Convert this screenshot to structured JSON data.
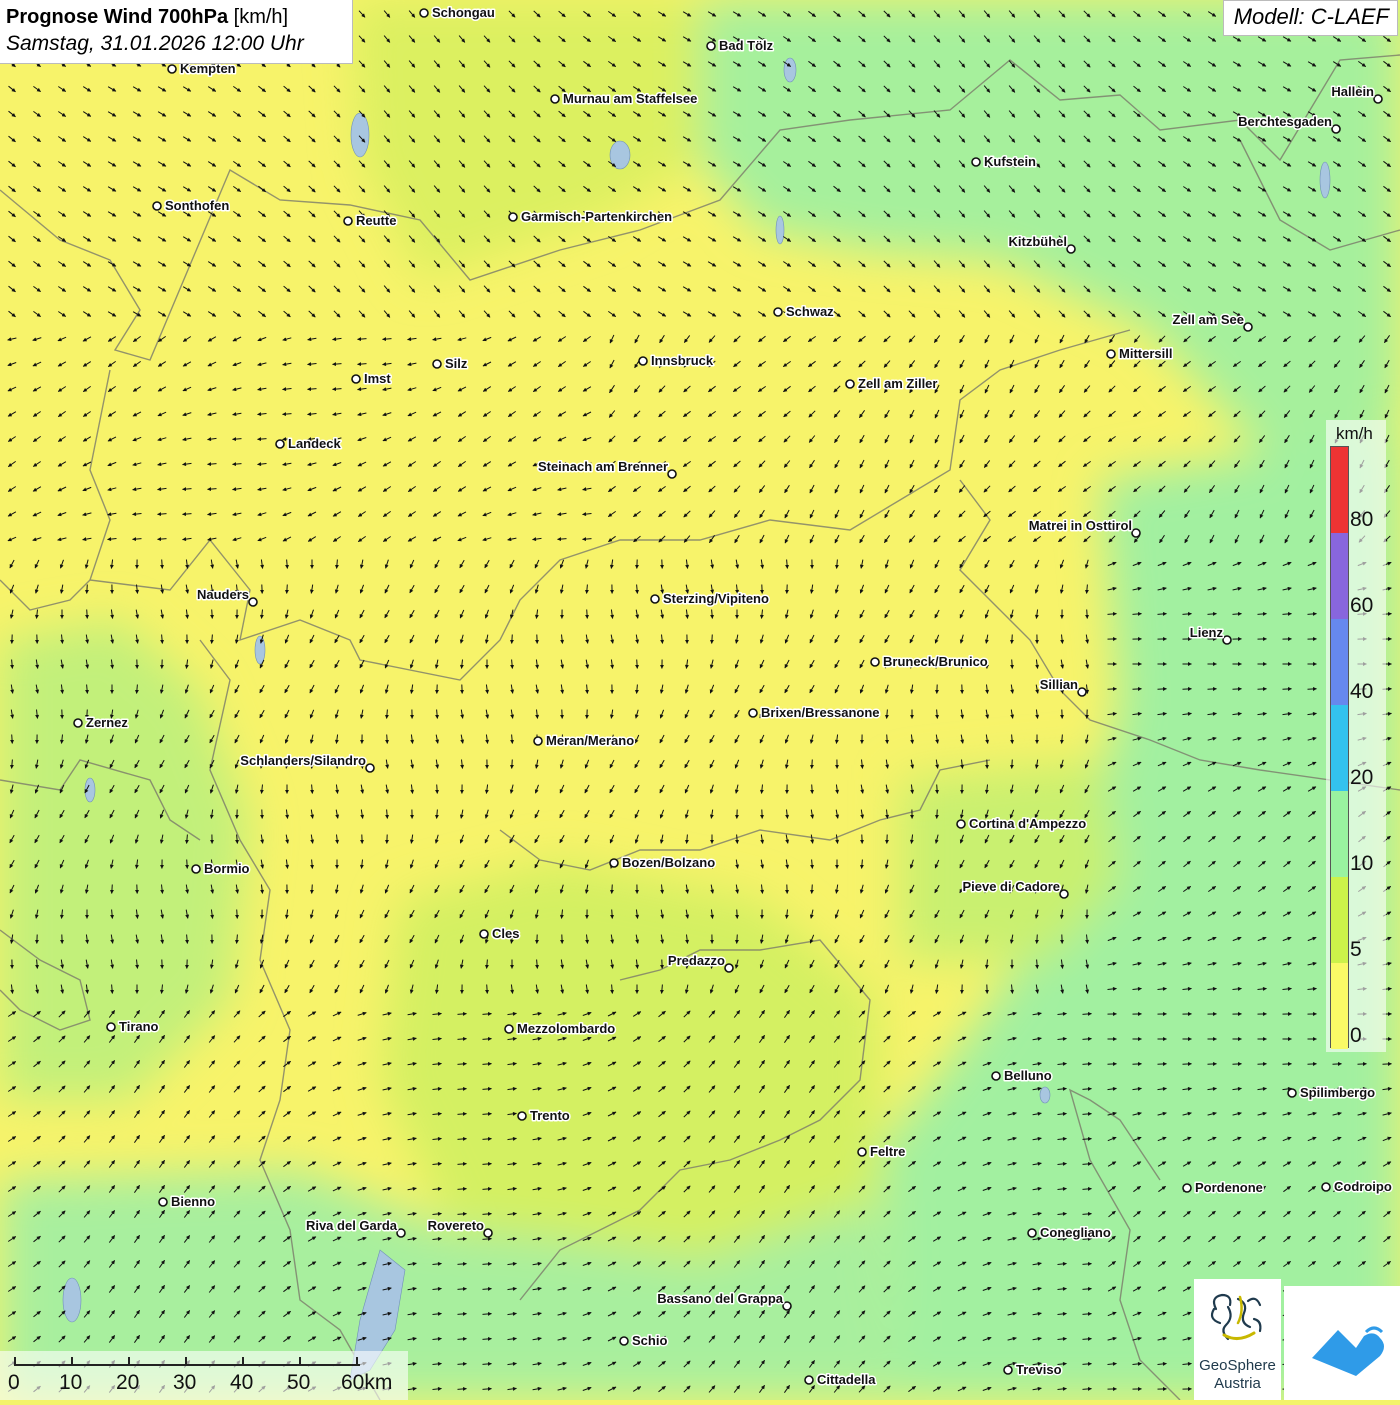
{
  "title": {
    "main": "Prognose Wind 700hPa",
    "unit": "[km/h]",
    "datetime": "Samstag, 31.01.2026 12:00 Uhr"
  },
  "model": "Modell: C-LAEF",
  "legend": {
    "unit": "km/h",
    "ticks": [
      "80",
      "60",
      "40",
      "20",
      "10",
      "5",
      "0"
    ],
    "classes": [
      {
        "from": 0,
        "to": 5,
        "color": "#fafa66"
      },
      {
        "from": 5,
        "to": 10,
        "color": "#ccf24a"
      },
      {
        "from": 10,
        "to": 20,
        "color": "#99f2a0"
      },
      {
        "from": 20,
        "to": 40,
        "color": "#33c2ee"
      },
      {
        "from": 40,
        "to": 60,
        "color": "#6688ee"
      },
      {
        "from": 60,
        "to": 80,
        "color": "#8866dd"
      },
      {
        "from": 80,
        "to": 999,
        "color": "#ee3333"
      }
    ]
  },
  "scalebar": {
    "labels": [
      "0",
      "10",
      "20",
      "30",
      "40",
      "50",
      "60km"
    ]
  },
  "logos": {
    "geosphere": "GeoSphere Austria"
  },
  "cities": [
    {
      "name": "Schongau"
    },
    {
      "name": "Bad Tölz"
    },
    {
      "name": "Kempten"
    },
    {
      "name": "Murnau am Staffelsee"
    },
    {
      "name": "Hallein"
    },
    {
      "name": "Berchtesgaden"
    },
    {
      "name": "Kufstein"
    },
    {
      "name": "Sonthofen"
    },
    {
      "name": "Reutte"
    },
    {
      "name": "Garmisch-Partenkirchen"
    },
    {
      "name": "Kitzbühel"
    },
    {
      "name": "Schwaz"
    },
    {
      "name": "Zell am See"
    },
    {
      "name": "Mittersill"
    },
    {
      "name": "Innsbruck"
    },
    {
      "name": "Silz"
    },
    {
      "name": "Imst"
    },
    {
      "name": "Zell am Ziller"
    },
    {
      "name": "Landeck"
    },
    {
      "name": "Steinach am Brenner"
    },
    {
      "name": "Matrei in Osttirol"
    },
    {
      "name": "Nauders"
    },
    {
      "name": "Sterzing/Vipiteno"
    },
    {
      "name": "Lienz"
    },
    {
      "name": "Bruneck/Brunico"
    },
    {
      "name": "Sillian"
    },
    {
      "name": "Brixen/Bressanone"
    },
    {
      "name": "Zernez"
    },
    {
      "name": "Meran/Merano"
    },
    {
      "name": "Schlanders/Silandro"
    },
    {
      "name": "Cortina d'Ampezzo"
    },
    {
      "name": "Bozen/Bolzano"
    },
    {
      "name": "Bormio"
    },
    {
      "name": "Pieve di Cadore"
    },
    {
      "name": "Cles"
    },
    {
      "name": "Predazzo"
    },
    {
      "name": "Tirano"
    },
    {
      "name": "Mezzolombardo"
    },
    {
      "name": "Belluno"
    },
    {
      "name": "Spilimbergo"
    },
    {
      "name": "Trento"
    },
    {
      "name": "Feltre"
    },
    {
      "name": "Pordenone"
    },
    {
      "name": "Codroipo"
    },
    {
      "name": "Bienno"
    },
    {
      "name": "Riva del Garda"
    },
    {
      "name": "Rovereto"
    },
    {
      "name": "Conegliano"
    },
    {
      "name": "Bassano del Grappa"
    },
    {
      "name": "Schio"
    },
    {
      "name": "Treviso"
    },
    {
      "name": "Cittadella"
    }
  ]
}
